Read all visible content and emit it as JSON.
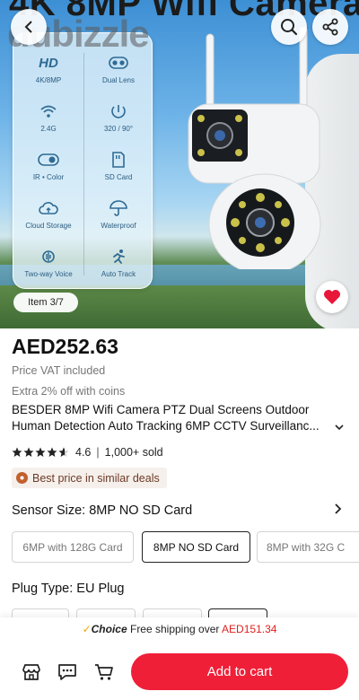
{
  "hero": {
    "title": "4K 8MP Wifi Camera",
    "watermark": "dubizzle",
    "item_counter": "Item 3/7",
    "specs": [
      {
        "icon": "hd-text",
        "value": "HD",
        "label": "4K/8MP"
      },
      {
        "icon": "dual-lens-icon",
        "label": "Dual Lens"
      },
      {
        "icon": "wifi-icon",
        "label": "2.4G"
      },
      {
        "icon": "rotate-icon",
        "label": "320 / 90°"
      },
      {
        "icon": "ir-toggle-icon",
        "label": "IR • Color"
      },
      {
        "icon": "sd-card-icon",
        "label": "SD Card"
      },
      {
        "icon": "cloud-icon",
        "label": "Cloud Storage"
      },
      {
        "icon": "umbrella-icon",
        "label": "Waterproof"
      },
      {
        "icon": "voice-icon",
        "label": "Two-way Voice"
      },
      {
        "icon": "running-icon",
        "label": "Auto Track"
      }
    ]
  },
  "product": {
    "price": "AED252.63",
    "vat_note": "Price VAT included",
    "coins_note": "Extra 2% off with coins",
    "title_line1": "BESDER 8MP Wifi Camera PTZ Dual Screens Outdoor",
    "title_line2": "Human Detection Auto Tracking 6MP CCTV Surveillanc...",
    "rating": "4.6",
    "sold": "1,000+ sold",
    "rating_separator": "|",
    "badge": "Best price in similar deals"
  },
  "options": {
    "sensor_label": "Sensor Size: 8MP NO SD Card",
    "sensor_chips": [
      "6MP with 128G Card",
      "8MP NO SD Card",
      "8MP with 32G C"
    ],
    "plug_label": "Plug Type: EU Plug"
  },
  "bottom_bar": {
    "shipping_tick": "✓",
    "shipping_choice": "Choice",
    "shipping_text": "Free shipping over",
    "shipping_amount": "AED151.34",
    "cart_button": "Add to cart"
  },
  "colors": {
    "accent": "#ef1f38",
    "badge_text": "#6b3a26",
    "price": "#111111"
  }
}
